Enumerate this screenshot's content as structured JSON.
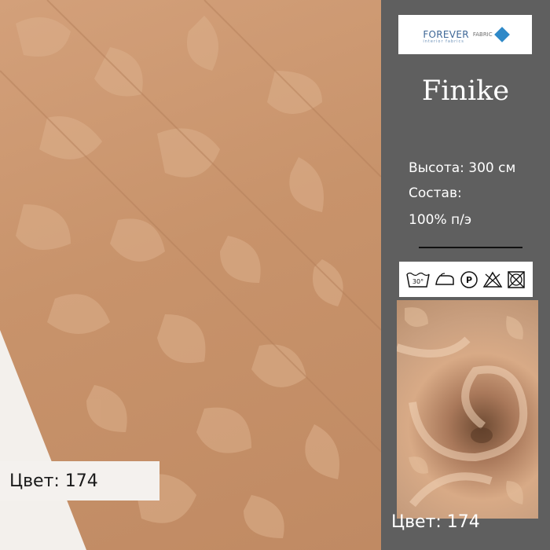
{
  "brand": {
    "name": "FOREVER",
    "tagline": "interior fabrics",
    "mark": "FABRIC"
  },
  "product": {
    "name": "Finike"
  },
  "specs": {
    "height": "Высота: 300 см",
    "composition_label": "Состав:",
    "composition_value": "100% п/э"
  },
  "care_icons": [
    "wash-30-icon",
    "iron-icon",
    "dry-clean-p-icon",
    "no-bleach-icon",
    "no-tumble-dry-icon"
  ],
  "care_text": {
    "wash_temp": "30°",
    "dry_clean": "P"
  },
  "color_label": "Цвет: 174",
  "colors": {
    "fabric": "#c8936b",
    "panel": "#5f5f5f",
    "pattern": "#dcb08c"
  }
}
